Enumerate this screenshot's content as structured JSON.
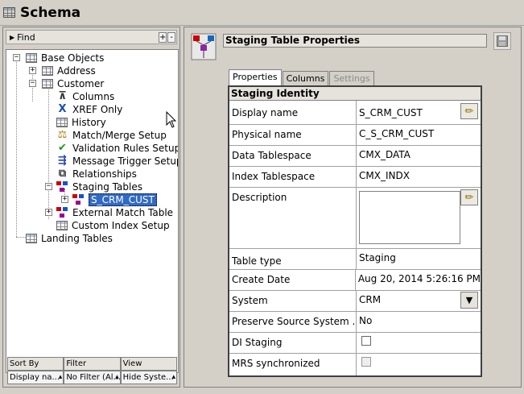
{
  "window": {
    "title": "Schema",
    "icon": "grid-icon"
  },
  "find": {
    "label": "Find",
    "plus": "+",
    "minus": "-"
  },
  "tree": {
    "base_objects": "Base Objects",
    "address": "Address",
    "customer": "Customer",
    "columns": "Columns",
    "xref_only": "XREF Only",
    "history": "History",
    "match_merge": "Match/Merge Setup",
    "validation": "Validation Rules Setup",
    "message_trigger": "Message Trigger Setup",
    "relationships": "Relationships",
    "staging_tables": "Staging Tables",
    "s_crm_cust": "S_CRM_CUST",
    "external_match": "External Match Table",
    "custom_index": "Custom Index Setup",
    "landing_tables": "Landing Tables"
  },
  "bottom": {
    "headers": [
      "Sort By",
      "Filter",
      "View"
    ],
    "values": [
      "Display na...",
      "No Filter (Al...",
      "Hide Syste..."
    ]
  },
  "panel": {
    "title": "Staging Table Properties",
    "tabs": [
      "Properties",
      "Columns",
      "Settings"
    ],
    "active_tab": "Properties",
    "section": "Staging Identity",
    "fields": {
      "display_name": {
        "label": "Display name",
        "value": "S_CRM_CUST"
      },
      "physical_name": {
        "label": "Physical name",
        "value": "C_S_CRM_CUST"
      },
      "data_tablespace": {
        "label": "Data Tablespace",
        "value": "CMX_DATA"
      },
      "index_tablespace": {
        "label": "Index Tablespace",
        "value": "CMX_INDX"
      },
      "description": {
        "label": "Description",
        "value": ""
      },
      "table_type": {
        "label": "Table type",
        "value": "Staging"
      },
      "create_date": {
        "label": "Create Date",
        "value": "Aug 20, 2014 5:26:16 PM"
      },
      "system": {
        "label": "System",
        "value": "CRM"
      },
      "preserve_source": {
        "label": "Preserve Source System ...",
        "value": "No"
      },
      "di_staging": {
        "label": "DI Staging",
        "checked": false
      },
      "mrs_synchronized": {
        "label": "MRS synchronized",
        "checked": false
      }
    }
  },
  "colors": {
    "selection": "#316ac5",
    "background": "#d4d0c8"
  }
}
